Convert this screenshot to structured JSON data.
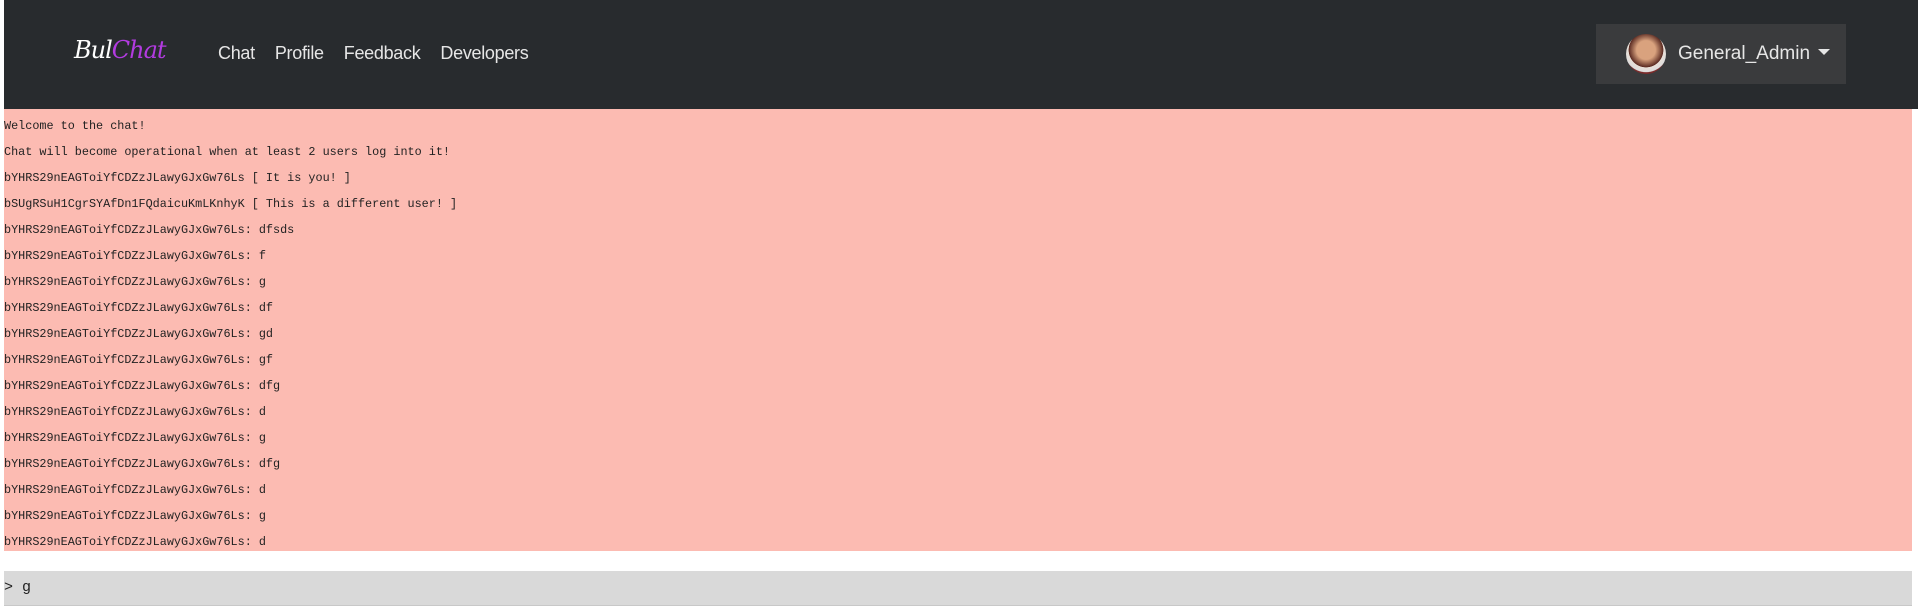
{
  "navbar": {
    "brand_part1": "Bul",
    "brand_part2": "Chat",
    "links": [
      "Chat",
      "Profile",
      "Feedback",
      "Developers"
    ],
    "user": "General_Admin"
  },
  "messages": [
    "Welcome to the chat!",
    "Chat will become operational when at least 2 users log into it!",
    "bYHRS29nEAGToiYfCDZzJLawyGJxGw76Ls [ It is you! ]",
    "bSUgRSuH1CgrSYAfDn1FQdaicuKmLKnhyK [ This is a different user! ]",
    "bYHRS29nEAGToiYfCDZzJLawyGJxGw76Ls: dfsds",
    "bYHRS29nEAGToiYfCDZzJLawyGJxGw76Ls: f",
    "bYHRS29nEAGToiYfCDZzJLawyGJxGw76Ls: g",
    "bYHRS29nEAGToiYfCDZzJLawyGJxGw76Ls: df",
    "bYHRS29nEAGToiYfCDZzJLawyGJxGw76Ls: gd",
    "bYHRS29nEAGToiYfCDZzJLawyGJxGw76Ls: gf",
    "bYHRS29nEAGToiYfCDZzJLawyGJxGw76Ls: dfg",
    "bYHRS29nEAGToiYfCDZzJLawyGJxGw76Ls: d",
    "bYHRS29nEAGToiYfCDZzJLawyGJxGw76Ls: g",
    "bYHRS29nEAGToiYfCDZzJLawyGJxGw76Ls: dfg",
    "bYHRS29nEAGToiYfCDZzJLawyGJxGw76Ls: d",
    "bYHRS29nEAGToiYfCDZzJLawyGJxGw76Ls: g",
    "bYHRS29nEAGToiYfCDZzJLawyGJxGw76Ls: d"
  ],
  "input": {
    "value": "> g"
  },
  "colors": {
    "navbar": "#282b2e",
    "chat_bg": "#fcbbb2",
    "brand_accent": "#b23be0",
    "input_bg": "#d9d9d9"
  }
}
